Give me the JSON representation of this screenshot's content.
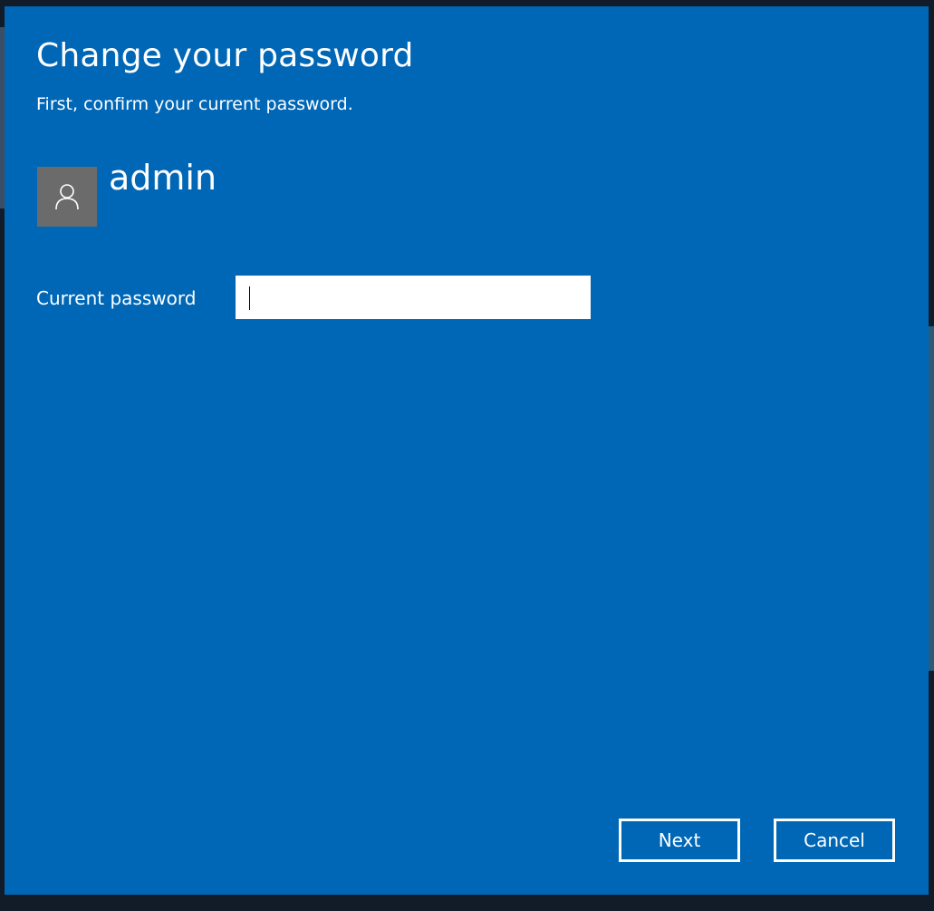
{
  "dialog": {
    "title": "Change your password",
    "subtitle": "First, confirm your current password."
  },
  "user": {
    "name": "admin",
    "avatar_icon": "person-icon"
  },
  "form": {
    "current_password_label": "Current password",
    "current_password_value": "",
    "current_password_placeholder": ""
  },
  "buttons": {
    "next_label": "Next",
    "cancel_label": "Cancel"
  },
  "colors": {
    "dialog_background": "#0067b6",
    "avatar_background": "#6b6b6b",
    "text": "#ffffff",
    "input_background": "#ffffff"
  }
}
